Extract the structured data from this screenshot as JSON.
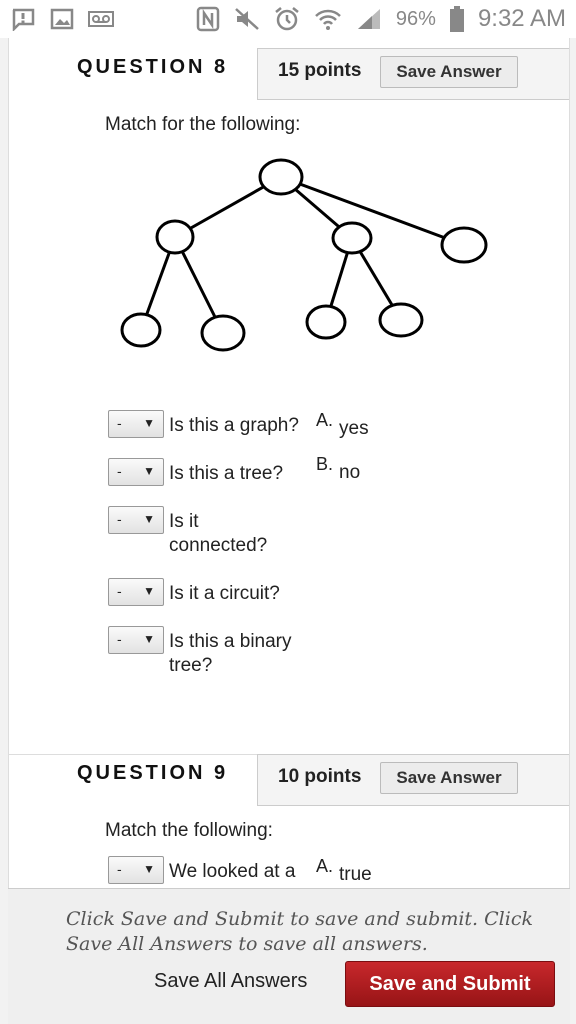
{
  "status_bar": {
    "battery": "96%",
    "time": "9:32 AM",
    "left_icons": [
      "alert-icon",
      "image-icon",
      "voicemail-icon"
    ],
    "right_icons": [
      "nfc-icon",
      "mute-icon",
      "alarm-icon",
      "wifi-icon",
      "signal-icon",
      "battery-icon"
    ]
  },
  "question8": {
    "title": "QUESTION 8",
    "points": "15 points",
    "save_label": "Save Answer",
    "prompt": "Match for the following:",
    "rows": [
      {
        "selected": "-",
        "question": "Is this a graph?"
      },
      {
        "selected": "-",
        "question": "Is this a tree?"
      },
      {
        "selected": "-",
        "question": "Is it connected?"
      },
      {
        "selected": "-",
        "question": "Is it a circuit?"
      },
      {
        "selected": "-",
        "question": "Is this a binary tree?"
      }
    ],
    "answers": [
      {
        "letter": "A.",
        "text": "yes"
      },
      {
        "letter": "B.",
        "text": "no"
      }
    ]
  },
  "question9": {
    "title": "QUESTION 9",
    "points": "10 points",
    "save_label": "Save Answer",
    "prompt": "Match the following:",
    "rows": [
      {
        "selected": "-",
        "question": "We looked at a"
      }
    ],
    "answers": [
      {
        "letter": "A.",
        "text": "true"
      }
    ]
  },
  "footer": {
    "note": "Click Save and Submit to save and submit. Click Save All Answers to save all answers.",
    "save_all_label": "Save All Answers",
    "submit_label": "Save and Submit"
  },
  "colors": {
    "submit_button": "#b01e22",
    "tab_background": "#f4f4f4",
    "page_background": "#ffffff"
  }
}
